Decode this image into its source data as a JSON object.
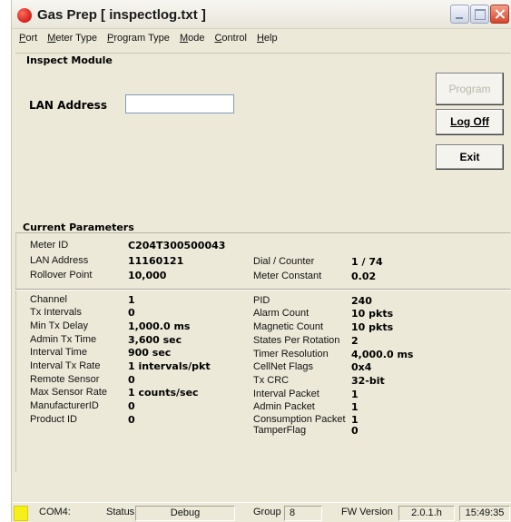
{
  "window": {
    "title": "Gas Prep  [ inspectlog.txt ]"
  },
  "menu": [
    {
      "label": "Port",
      "accel": "P"
    },
    {
      "label": "Meter Type",
      "accel": "M"
    },
    {
      "label": "Program Type",
      "accel": "P"
    },
    {
      "label": "Mode",
      "accel": "M"
    },
    {
      "label": "Control",
      "accel": "C"
    },
    {
      "label": "Help",
      "accel": "H"
    }
  ],
  "inspect": {
    "title": "Inspect Module",
    "lan_label": "LAN Address",
    "lan_value": "",
    "program_button": "Program",
    "logoff_button": "Log Off",
    "exit_button": "Exit"
  },
  "params": {
    "title": "Current Parameters",
    "top": {
      "meter_id": {
        "label": "Meter ID",
        "value": "C204T300500043"
      },
      "lan_address": {
        "label": "LAN Address",
        "value": "11160121"
      },
      "rollover": {
        "label": "Rollover Point",
        "value": "10,000"
      },
      "dial": {
        "label": "Dial / Counter",
        "value": "1 / 74"
      },
      "meter_constant": {
        "label": "Meter Constant",
        "value": "0.02"
      }
    },
    "left": [
      {
        "label": "Channel",
        "value": "1"
      },
      {
        "label": "Tx Intervals",
        "value": "0"
      },
      {
        "label": "Min Tx Delay",
        "value": "1,000.0 ms"
      },
      {
        "label": "Admin Tx Time",
        "value": "3,600 sec"
      },
      {
        "label": "Interval Time",
        "value": "900 sec"
      },
      {
        "label": "Interval Tx Rate",
        "value": "1 intervals/pkt"
      },
      {
        "label": "Remote Sensor",
        "value": "0"
      },
      {
        "label": "Max Sensor Rate",
        "value": "1 counts/sec"
      },
      {
        "label": "ManufacturerID",
        "value": "0"
      },
      {
        "label": "Product ID",
        "value": "0"
      }
    ],
    "right": [
      {
        "label": "PID",
        "value": "240"
      },
      {
        "label": "Alarm Count",
        "value": "10 pkts"
      },
      {
        "label": "Magnetic Count",
        "value": "10 pkts"
      },
      {
        "label": "States Per Rotation",
        "value": "2"
      },
      {
        "label": "Timer Resolution",
        "value": "4,000.0 ms"
      },
      {
        "label": "CellNet Flags",
        "value": "0x4"
      },
      {
        "label": "Tx CRC",
        "value": "32-bit"
      },
      {
        "label": "Interval Packet",
        "value": "1"
      },
      {
        "label": "Admin Packet",
        "value": "1"
      },
      {
        "label": "Consumption Packet",
        "value": "1"
      },
      {
        "label": "TamperFlag",
        "value": "0"
      }
    ]
  },
  "statusbar": {
    "port": "COM4:",
    "status_label": "Status",
    "mode": "Debug",
    "group_label": "Group",
    "group_value": "8",
    "fw_label": "FW Version",
    "fw_value": "2.0.1.h",
    "time": "15:49:35",
    "led_color": "#f7ef1b"
  },
  "colors": {
    "window_bg": "#ece9d8",
    "close_button": "#d4442a",
    "app_icon": "#c00000"
  }
}
